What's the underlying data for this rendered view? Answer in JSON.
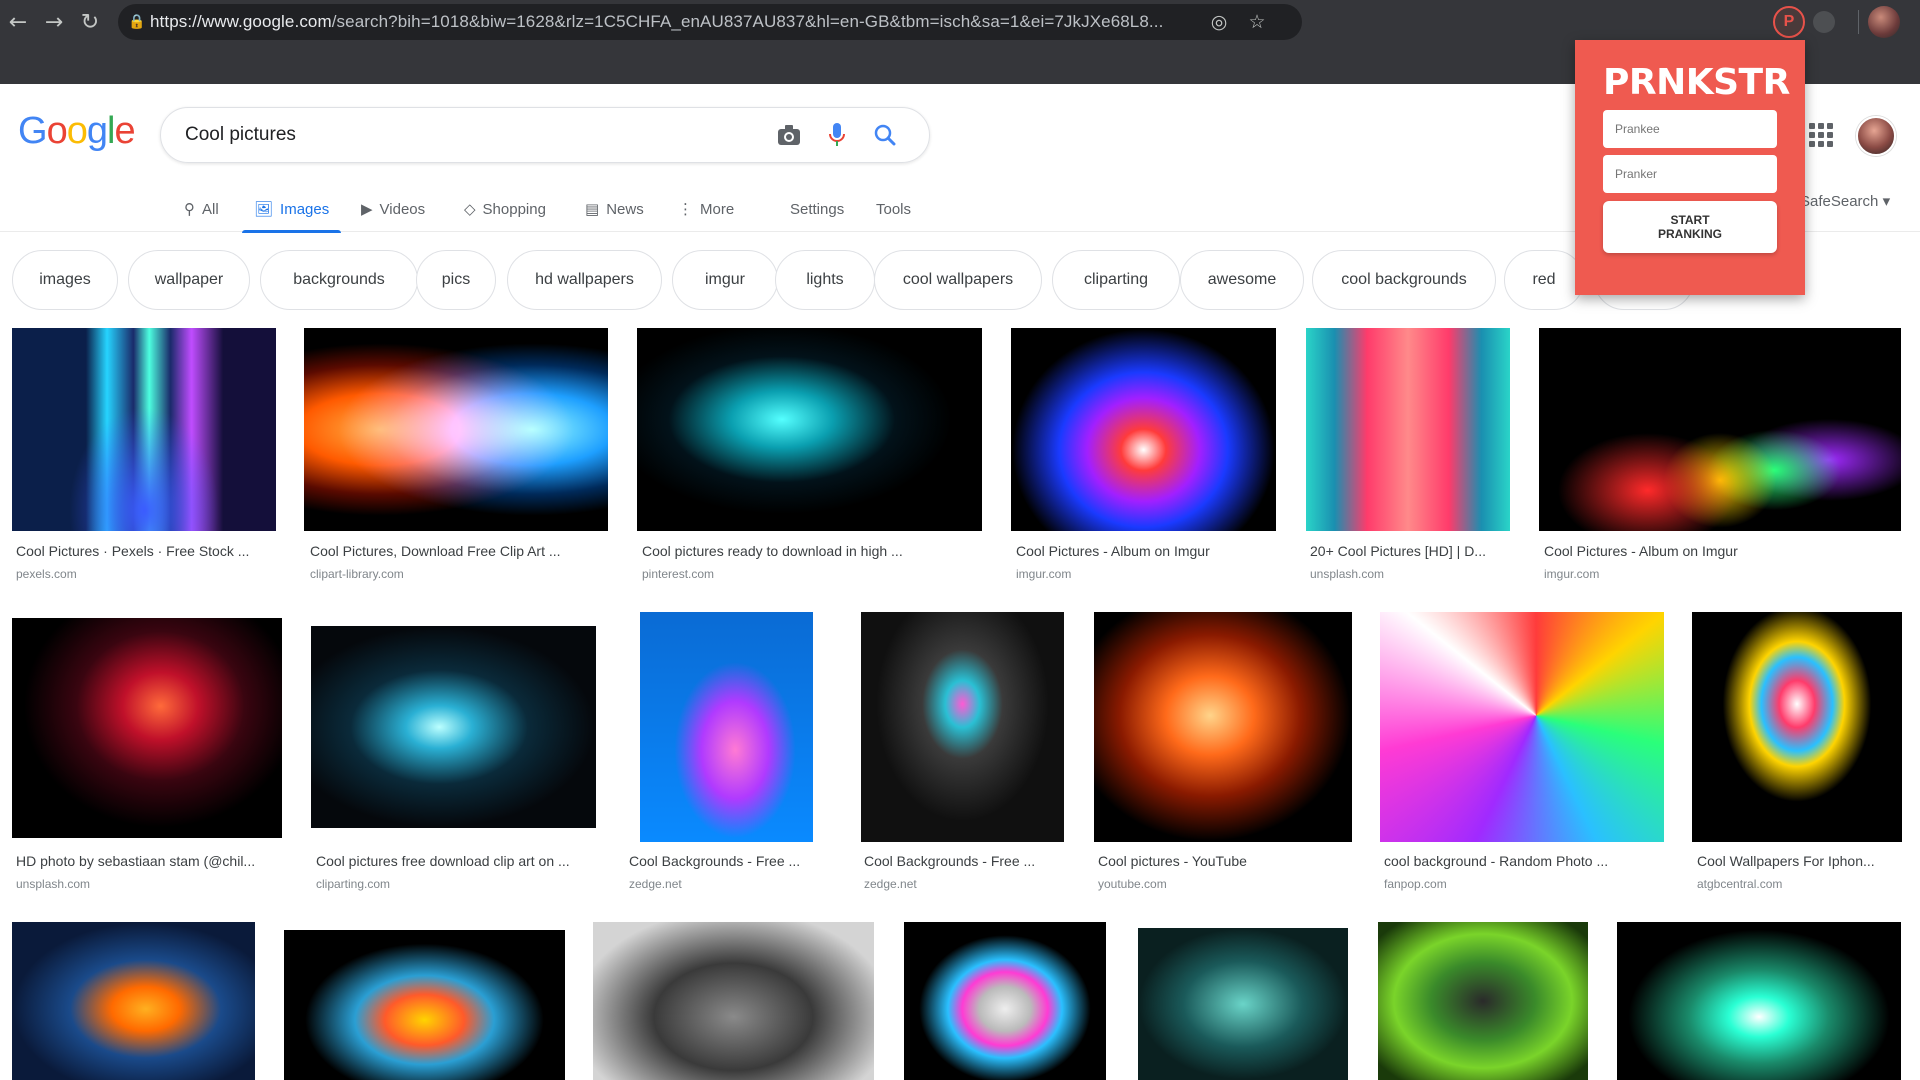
{
  "browser": {
    "url_host": "https://www.google.com",
    "url_rest": "/search?bih=1018&biw=1628&rlz=1C5CHFA_enAU837AU837&hl=en-GB&tbm=isch&sa=1&ei=7JkJXe68L8..."
  },
  "search": {
    "query": "Cool pictures"
  },
  "tabs": [
    {
      "label": "All",
      "icon": "search-icon"
    },
    {
      "label": "Images",
      "icon": "image-icon"
    },
    {
      "label": "Videos",
      "icon": "video-icon"
    },
    {
      "label": "Shopping",
      "icon": "tag-icon"
    },
    {
      "label": "News",
      "icon": "news-icon"
    },
    {
      "label": "More",
      "icon": "more-vert-icon"
    },
    {
      "label": "Settings"
    },
    {
      "label": "Tools"
    }
  ],
  "safesearch": "SafeSearch",
  "chips": [
    "images",
    "wallpaper",
    "backgrounds",
    "pics",
    "hd wallpapers",
    "imgur",
    "lights",
    "cool wallpapers",
    "cliparting",
    "awesome",
    "cool backgrounds",
    "red"
  ],
  "results": [
    {
      "caption": "Cool Pictures · Pexels · Free Stock ...",
      "source": "pexels.com"
    },
    {
      "caption": "Cool Pictures, Download Free Clip Art ...",
      "source": "clipart-library.com"
    },
    {
      "caption": "Cool pictures ready to download in high ...",
      "source": "pinterest.com"
    },
    {
      "caption": "Cool Pictures - Album on Imgur",
      "source": "imgur.com"
    },
    {
      "caption": "20+ Cool Pictures [HD] | D...",
      "source": "unsplash.com"
    },
    {
      "caption": "Cool Pictures - Album on Imgur",
      "source": "imgur.com"
    },
    {
      "caption": "HD photo by sebastiaan stam (@chil...",
      "source": "unsplash.com"
    },
    {
      "caption": "Cool pictures free download clip art on ...",
      "source": "cliparting.com"
    },
    {
      "caption": "Cool Backgrounds - Free ...",
      "source": "zedge.net"
    },
    {
      "caption": "Cool Backgrounds - Free ...",
      "source": "zedge.net"
    },
    {
      "caption": "Cool pictures - YouTube",
      "source": "youtube.com"
    },
    {
      "caption": "cool background - Random Photo ...",
      "source": "fanpop.com"
    },
    {
      "caption": "Cool Wallpapers For Iphon...",
      "source": "atgbcentral.com"
    }
  ],
  "prankster": {
    "brand": "PRNKSTR",
    "prankee_placeholder": "Prankee",
    "pranker_placeholder": "Pranker",
    "start_label": "START\nPRANKING",
    "color": "#ef5a50"
  }
}
